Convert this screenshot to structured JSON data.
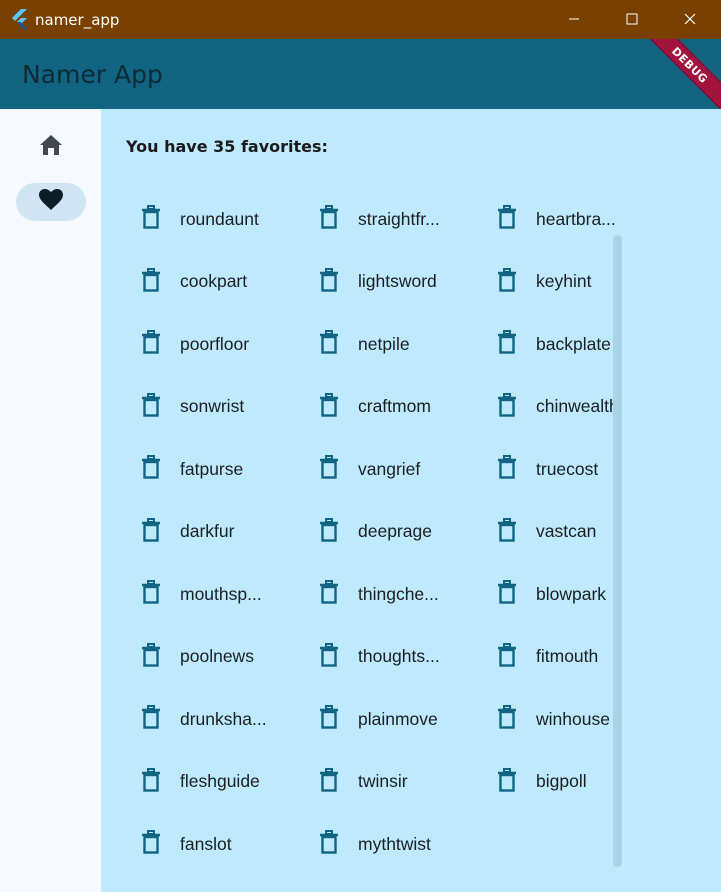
{
  "window": {
    "title": "namer_app",
    "icon": "flutter-icon",
    "controls": [
      "minimize-icon",
      "maximize-icon",
      "close-icon"
    ]
  },
  "appbar": {
    "title": "Namer App",
    "debug_banner": "DEBUG",
    "color": "#116582"
  },
  "navrail": {
    "items": [
      {
        "icon": "home-icon",
        "selected": false
      },
      {
        "icon": "heart-icon",
        "selected": true
      }
    ]
  },
  "main": {
    "header": "You have 35 favorites:",
    "favorites": [
      "roundaunt",
      "straightfr...",
      "heartbra...",
      "cookpart",
      "lightsword",
      "keyhint",
      "poorfloor",
      "netpile",
      "backplate",
      "sonwrist",
      "craftmom",
      "chinwealth",
      "fatpurse",
      "vangrief",
      "truecost",
      "darkfur",
      "deeprage",
      "vastcan",
      "mouthsp...",
      "thingche...",
      "blowpark",
      "poolnews",
      "thoughts...",
      "fitmouth",
      "drunksha...",
      "plainmove",
      "winhouse",
      "fleshguide",
      "twinsir",
      "bigpoll",
      "fanslot",
      "mythtwist"
    ],
    "delete_icon": "trash-icon",
    "accent": "#116582",
    "background": "#bfe9fd"
  }
}
